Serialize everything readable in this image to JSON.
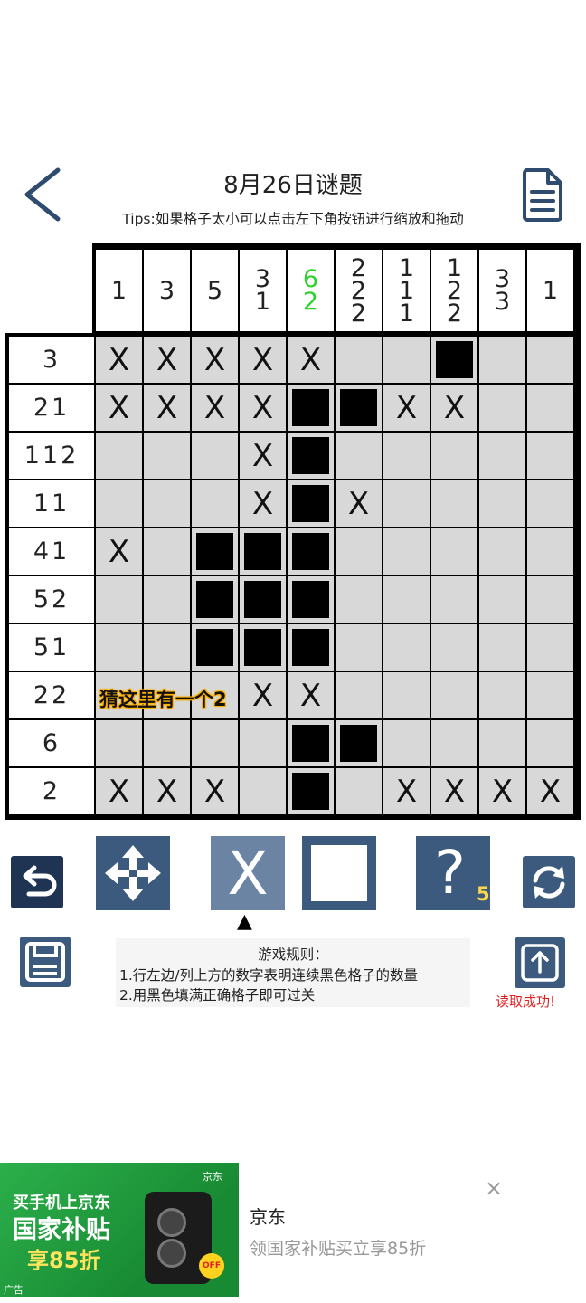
{
  "header": {
    "title": "8月26日谜题",
    "tips": "Tips:如果格子太小可以点击左下角按钮进行缩放和拖动"
  },
  "puzzle": {
    "column_clues": [
      [
        "1"
      ],
      [
        "3"
      ],
      [
        "5"
      ],
      [
        "3",
        "1"
      ],
      [
        "6",
        "2"
      ],
      [
        "2",
        "2",
        "2"
      ],
      [
        "1",
        "1",
        "1"
      ],
      [
        "1",
        "2",
        "2"
      ],
      [
        "3",
        "3"
      ],
      [
        "1"
      ]
    ],
    "highlighted_column": 4,
    "highlight_color": "#2fd12f",
    "row_clues": [
      "3",
      "21",
      "112",
      "11",
      "41",
      "52",
      "51",
      "22",
      "6",
      "2"
    ],
    "grid": [
      [
        "X",
        "X",
        "X",
        "X",
        "X",
        "",
        "",
        "B",
        "",
        ""
      ],
      [
        "X",
        "X",
        "X",
        "X",
        "B",
        "B",
        "X",
        "X",
        "",
        ""
      ],
      [
        "",
        "",
        "",
        "X",
        "B",
        "",
        "",
        "",
        "",
        ""
      ],
      [
        "",
        "",
        "",
        "X",
        "B",
        "X",
        "",
        "",
        "",
        ""
      ],
      [
        "X",
        "",
        "B",
        "B",
        "B",
        "",
        "",
        "",
        "",
        ""
      ],
      [
        "",
        "",
        "B",
        "B",
        "B",
        "",
        "",
        "",
        "",
        ""
      ],
      [
        "",
        "",
        "B",
        "B",
        "B",
        "",
        "",
        "",
        "",
        ""
      ],
      [
        "",
        "",
        "",
        "X",
        "X",
        "",
        "",
        "",
        "",
        ""
      ],
      [
        "",
        "",
        "",
        "",
        "B",
        "B",
        "",
        "",
        "",
        ""
      ],
      [
        "X",
        "X",
        "X",
        "",
        "B",
        "",
        "X",
        "X",
        "X",
        "X"
      ]
    ],
    "hint_text": "猜这里有一个2"
  },
  "toolbar": {
    "x_mode_label": "X",
    "help_label": "?",
    "help_count": "5",
    "pointer": "▲"
  },
  "rules": {
    "title": "游戏规则：",
    "rule1": "1.行左边/列上方的数字表明连续黑色格子的数量",
    "rule2": "2.用黑色填满正确格子即可过关"
  },
  "load_status": "读取成功!",
  "colors": {
    "button_navy": "#3c5a7d",
    "button_dark": "#1f3452",
    "cell_empty": "#d8d8d8",
    "status_red": "#e02020"
  },
  "ad": {
    "line1": "买手机上京东",
    "line2": "国家补贴",
    "line3": "享85折",
    "brand_logo": "京东",
    "off_badge": "OFF",
    "tag": "广告",
    "name": "京东",
    "description": "领国家补贴买立享85折",
    "close": "×"
  }
}
